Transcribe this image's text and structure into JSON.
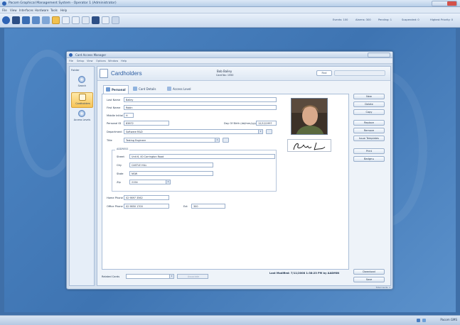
{
  "app": {
    "title": "Pacom Graphical Management System - Operator 1 (Administrator)"
  },
  "menubar": [
    "File",
    "View",
    "Interfaces",
    "Hardware",
    "Tools",
    "Help"
  ],
  "toolbar": {
    "status": [
      "Events: 100",
      "Alarms: 300",
      "Pending: 1",
      "Suspended: 0",
      "Highest Priority: 0"
    ]
  },
  "child": {
    "title": "Card Access Manager",
    "menu": [
      "File",
      "Setup",
      "View",
      "Options",
      "Window",
      "Help"
    ],
    "nav": {
      "heading": "Folder",
      "items": [
        {
          "label": "Search"
        },
        {
          "label": "Cardholders"
        },
        {
          "label": "Access Levels"
        }
      ]
    },
    "header": {
      "title": "Cardholders",
      "name": "Bob Bailey",
      "card": "Card No: 1550",
      "find": "Find"
    },
    "tabs": [
      "Personal",
      "Card Details",
      "Access Level"
    ],
    "form": {
      "last_name_label": "Last Name",
      "last_name": "Bailey",
      "first_name_label": "First Name",
      "first_name": "Robin",
      "middle_label": "Middle Initial",
      "middle": "H",
      "personal_id_label": "Personal ID",
      "personal_id": "83672",
      "dob_label": "Day Of Birth (dd/mm/yyyy)",
      "dob": "12/12/1997",
      "department_label": "Department",
      "department": "Software R&D",
      "title_label": "Title",
      "title": "Testing Engineer",
      "address_legend": "ADDRESS",
      "street_label": "Street",
      "street": "Unit 6, 40 Carrington Road",
      "city_label": "City",
      "city": "CASTLE HILL",
      "state_label": "State",
      "state": "NSW",
      "zip_label": "Zip",
      "zip": "2154",
      "home_phone_label": "Home Phone",
      "home_phone": "02 9897 3562",
      "office_phone_label": "Office Phone",
      "office_phone": "02 9850 1700",
      "ext_label": "Ext",
      "ext": "300"
    },
    "actions": [
      "New",
      "Delete",
      "Copy",
      "Replace",
      "Remove",
      "Issue Templates",
      "Print",
      "Badge",
      "Download",
      "Save"
    ],
    "footer": {
      "related_label": "Related Cards",
      "related_btn": "Associate",
      "last_modified": "Last Modified: 7/11/2008 1:38:23 PM by AADMIN"
    },
    "statusbar": "Total Cards: 1"
  },
  "tray": {
    "clock": "Pacom GMS"
  }
}
